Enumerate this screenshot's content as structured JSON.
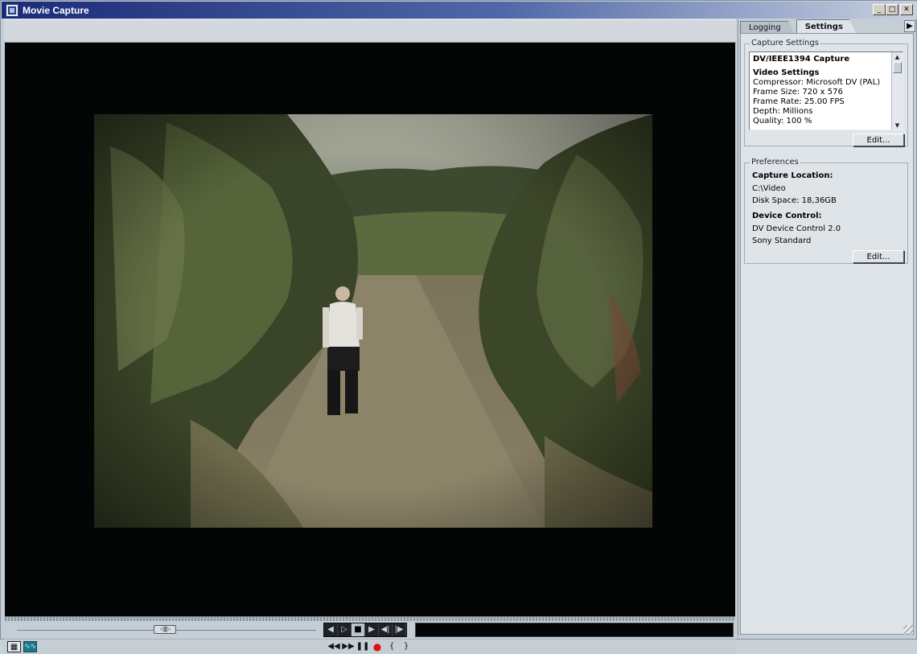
{
  "window": {
    "title": "Movie Capture",
    "minimize_glyph": "_",
    "maximize_glyph": "□",
    "close_glyph": "✕"
  },
  "tabs": [
    {
      "label": "Logging",
      "active": false
    },
    {
      "label": "Settings",
      "active": true
    }
  ],
  "panel_menu_glyph": "▶",
  "capture_settings": {
    "legend": "Capture Settings",
    "title": "DV/IEEE1394 Capture",
    "video_heading": "Video Settings",
    "lines": [
      "Compressor: Microsoft DV (PAL)",
      "Frame Size: 720 x 576",
      "Frame Rate: 25.00 FPS",
      "Depth: Millions",
      "Quality: 100 %"
    ],
    "edit_label": "Edit..."
  },
  "preferences": {
    "legend": "Preferences",
    "capture_location_heading": "Capture Location:",
    "capture_path": "C:\\Video",
    "disk_space": "Disk Space: 18,36GB",
    "device_control_heading": "Device Control:",
    "device_control_line1": "DV Device Control 2.0",
    "device_control_line2": "Sony Standard",
    "edit_label": "Edit..."
  },
  "transport": {
    "shuttle_glyph": "◁|||▷",
    "buttons": [
      "step-back",
      "step-forward",
      "stop",
      "play",
      "go-to-in",
      "go-to-out"
    ],
    "glyphs": {
      "step_back": "◀",
      "step_forward": "▷",
      "stop": "■",
      "play": "▶",
      "go_in": "◀|",
      "go_out": "|▶"
    }
  },
  "bottom_controls": {
    "rewind": "◀◀",
    "fast_forward": "▶▶",
    "pause": "❚❚",
    "record": "●",
    "mark_in": "{",
    "mark_out": "}",
    "filmstrip": "▦",
    "waveform": "∿∿"
  },
  "colors": {
    "titlebar_start": "#1a2a78",
    "record_red": "#e01010",
    "panel_bg": "#dfe4e9"
  }
}
